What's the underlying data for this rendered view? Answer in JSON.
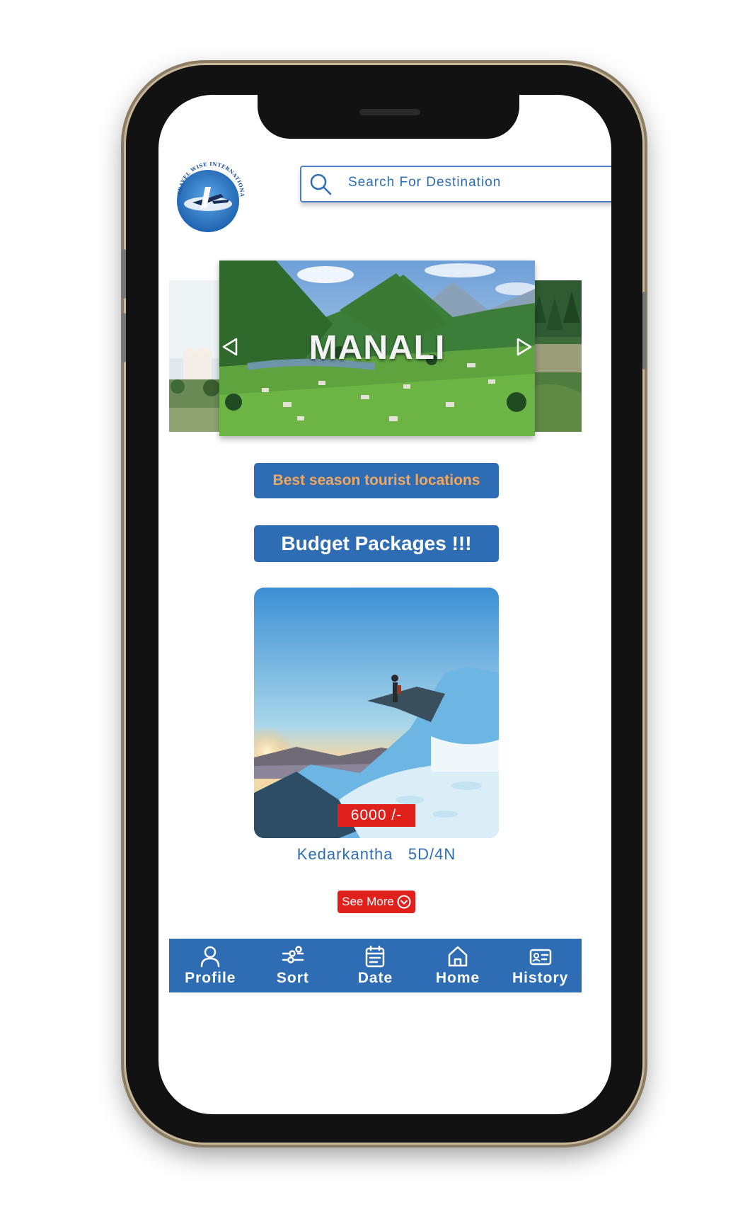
{
  "app": {
    "logo_text": "TRAVEL WISE INTERNATIONAL",
    "brand_color": "#2e6db4",
    "accent_red": "#e0201b",
    "accent_orange": "#f3a65d"
  },
  "search": {
    "placeholder": "Search For Destination",
    "icon": "search-icon"
  },
  "carousel": {
    "title": "MANALI",
    "prev_icon": "chevron-left-icon",
    "next_icon": "chevron-right-icon"
  },
  "sections": {
    "season_label": "Best season tourist locations",
    "budget_label": "Budget Packages !!!"
  },
  "package": {
    "price": "6000 /-",
    "name": "Kedarkantha",
    "duration": "5D/4N",
    "see_more_label": "See More",
    "see_more_icon": "chevron-down-circle-icon"
  },
  "nav": {
    "items": [
      {
        "label": "Profile",
        "icon": "user-icon"
      },
      {
        "label": "Sort",
        "icon": "sort-icon"
      },
      {
        "label": "Date",
        "icon": "calendar-icon"
      },
      {
        "label": "Home",
        "icon": "home-icon"
      },
      {
        "label": "History",
        "icon": "id-card-icon"
      }
    ]
  }
}
